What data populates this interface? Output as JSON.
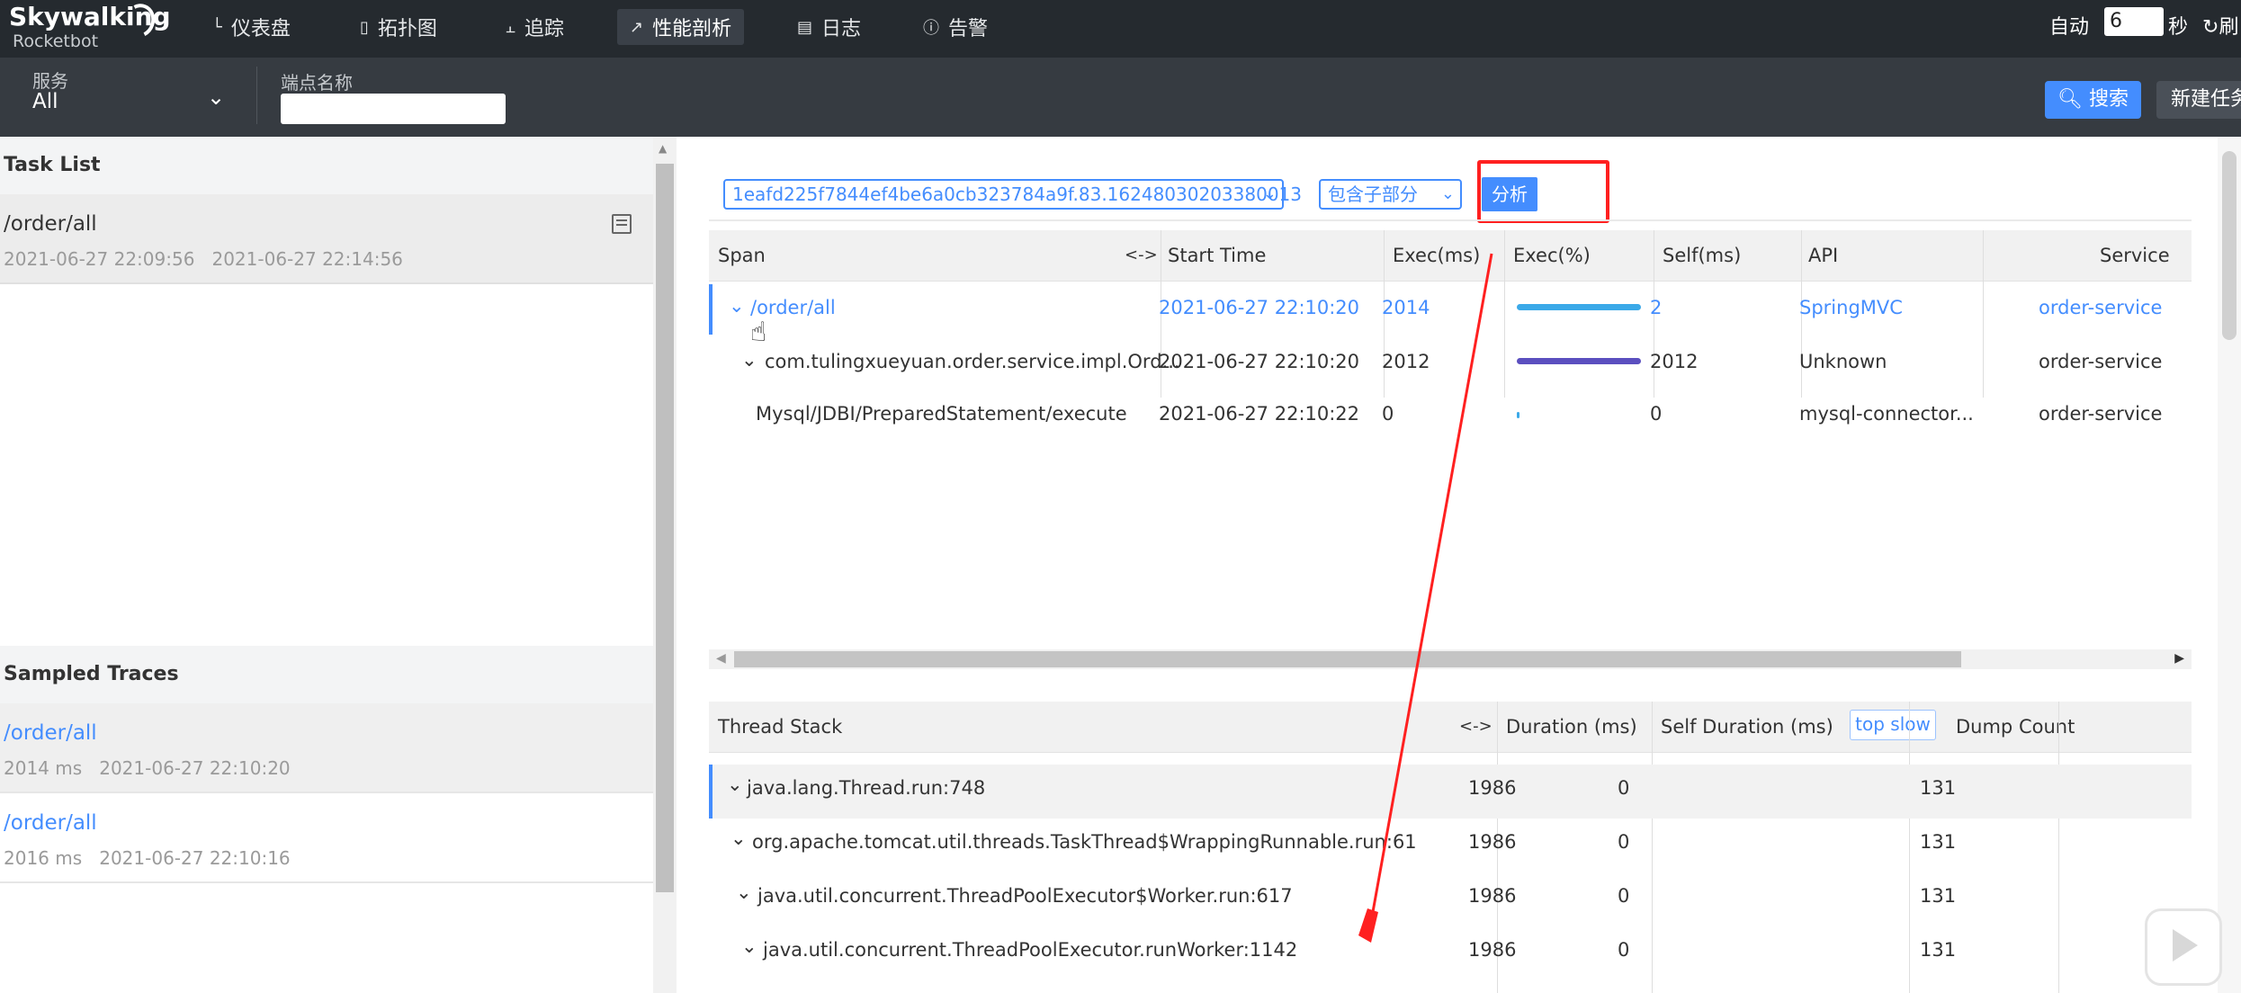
{
  "app": {
    "brand_name": "Skywalking",
    "brand_sub": "Rocketbot"
  },
  "nav": [
    {
      "icon": "dashboard-icon",
      "label": "仪表盘"
    },
    {
      "icon": "topology-icon",
      "label": "拓扑图"
    },
    {
      "icon": "trace-icon",
      "label": "追踪"
    },
    {
      "icon": "profile-icon",
      "label": "性能剖析"
    },
    {
      "icon": "log-icon",
      "label": "日志"
    },
    {
      "icon": "alarm-icon",
      "label": "告警"
    }
  ],
  "topright": {
    "auto_label": "自动",
    "interval_value": "6",
    "seconds_label": "秒",
    "refresh_label": "刷"
  },
  "filter": {
    "service_label": "服务",
    "service_value": "All",
    "endpoint_label": "端点名称",
    "endpoint_value": "",
    "search_button": "搜索",
    "new_task_button": "新建任务"
  },
  "task_list": {
    "heading": "Task List",
    "items": [
      {
        "endpoint": "/order/all",
        "time_range": "2021-06-27 22:09:56   2021-06-27 22:14:56"
      }
    ]
  },
  "sampled": {
    "heading": "Sampled Traces",
    "items": [
      {
        "endpoint": "/order/all",
        "meta": "2014 ms   2021-06-27 22:10:20"
      },
      {
        "endpoint": "/order/all",
        "meta": "2016 ms   2021-06-27 22:10:16"
      }
    ]
  },
  "analysis": {
    "trace_id": "1eafd225f7844ef4be6a0cb323784a9f.83.16248030203380013",
    "mode": "包含子部分",
    "analyze_button": "分析"
  },
  "span_table": {
    "columns": [
      "Span",
      "Start Time",
      "Exec(ms)",
      "Exec(%)",
      "Self(ms)",
      "API",
      "Service"
    ],
    "collapse_toggle": "<->",
    "rows": [
      {
        "span": "/order/all",
        "start": "2021-06-27 22:10:20",
        "exec": "2014",
        "exec_pct": 1.0,
        "self": "2",
        "api": "SpringMVC",
        "service": "order-service",
        "bar_color": "#3ba9e8"
      },
      {
        "span": "com.tulingxueyuan.order.service.impl.Ord...",
        "start": "2021-06-27 22:10:20",
        "exec": "2012",
        "exec_pct": 1.0,
        "self": "2012",
        "api": "Unknown",
        "service": "order-service",
        "bar_color": "#5b4fbf"
      },
      {
        "span": "Mysql/JDBI/PreparedStatement/execute",
        "start": "2021-06-27 22:10:22",
        "exec": "0",
        "exec_pct": 0.02,
        "self": "0",
        "api": "mysql-connector...",
        "service": "order-service",
        "bar_color": "#3ba9e8"
      }
    ]
  },
  "stack_table": {
    "columns": [
      "Thread Stack",
      "Duration (ms)",
      "Self Duration (ms)",
      "Dump Count"
    ],
    "collapse_toggle": "<->",
    "top_slow": "top slow",
    "rows": [
      {
        "frame": "java.lang.Thread.run:748",
        "duration": "1986",
        "self": "0",
        "count": "131"
      },
      {
        "frame": "org.apache.tomcat.util.threads.TaskThread$WrappingRunnable.run:61",
        "duration": "1986",
        "self": "0",
        "count": "131"
      },
      {
        "frame": "java.util.concurrent.ThreadPoolExecutor$Worker.run:617",
        "duration": "1986",
        "self": "0",
        "count": "131"
      },
      {
        "frame": "java.util.concurrent.ThreadPoolExecutor.runWorker:1142",
        "duration": "1986",
        "self": "0",
        "count": "131"
      }
    ]
  },
  "colors": {
    "accent": "#448dfe",
    "annotation": "#ff2020",
    "topbar": "#252a2f",
    "filterbar": "#363b41"
  }
}
